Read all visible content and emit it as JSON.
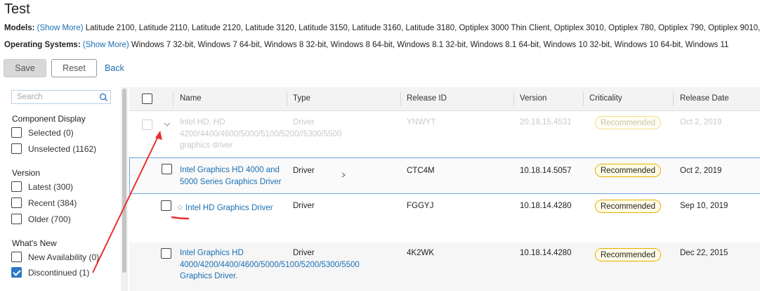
{
  "page": {
    "title": "Test"
  },
  "models": {
    "label": "Models:",
    "show_more": "(Show More)",
    "value": "Latitude 2100, Latitude 2110, Latitude 2120, Latitude 3120, Latitude 3150, Latitude 3160, Latitude 3180, Optiplex 3000 Thin Client, Optiplex 3010, Optiplex 780, Optiplex 790, Optiplex 9010, Optip"
  },
  "os": {
    "label": "Operating Systems:",
    "show_more": "(Show More)",
    "value": "Windows 7 32-bit, Windows 7 64-bit, Windows 8 32-bit, Windows 8 64-bit, Windows 8.1 32-bit, Windows 8.1 64-bit, Windows 10 32-bit, Windows 10 64-bit, Windows 11"
  },
  "actions": {
    "save": "Save",
    "reset": "Reset",
    "back": "Back"
  },
  "sidebar": {
    "search_placeholder": "Search",
    "component_display": {
      "title": "Component Display",
      "selected": "Selected (0)",
      "unselected": "Unselected (1162)"
    },
    "version": {
      "title": "Version",
      "latest": "Latest (300)",
      "recent": "Recent (384)",
      "older": "Older (700)"
    },
    "whats_new": {
      "title": "What's New",
      "new_availability": "New Availability (0)",
      "discontinued": "Discontinued (1)"
    }
  },
  "table": {
    "columns": [
      "Name",
      "Type",
      "Release ID",
      "Version",
      "Criticality",
      "Release Date"
    ],
    "rows": [
      {
        "name_lines": [
          "Intel HD, HD",
          "4200/4400/4600/5000/5100/5200//5300/5500",
          "graphics driver"
        ],
        "type": "Driver",
        "release_id": "YNWYT",
        "version": "20.19.15.4531",
        "criticality": "Recommended",
        "release_date": "Oct 2, 2019"
      },
      {
        "name_lines": [
          "Intel Graphics HD 4000 and",
          "5000 Series Graphics Driver"
        ],
        "type": "Driver",
        "release_id": "CTC4M",
        "version": "10.18.14.5057",
        "criticality": "Recommended",
        "release_date": "Oct 2, 2019"
      },
      {
        "name_lines": [
          "Intel HD Graphics Driver"
        ],
        "type": "Driver",
        "release_id": "FGGYJ",
        "version": "10.18.14.4280",
        "criticality": "Recommended",
        "release_date": "Sep 10, 2019"
      },
      {
        "name_lines": [
          "Intel Graphics HD",
          "4000/4200/4400/4600/5000/5100/5200/5300/5500",
          "Graphics Driver."
        ],
        "type": "Driver",
        "release_id": "4K2WK",
        "version": "10.18.14.4280",
        "criticality": "Recommended",
        "release_date": "Dec 22, 2015"
      }
    ]
  },
  "colors": {
    "link": "#1a6fb3",
    "checkbox_checked": "#2d78c6",
    "badge_border": "#e8b000",
    "annotation": "#e8312f"
  }
}
